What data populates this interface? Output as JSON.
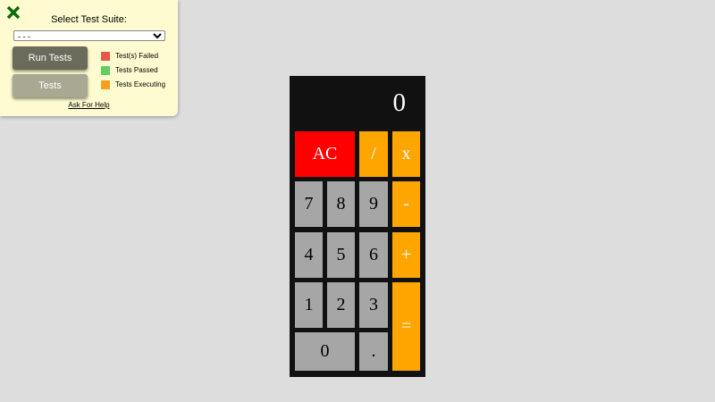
{
  "test_panel": {
    "close_icon": "close-x-icon",
    "title": "Select Test Suite:",
    "select_value": "- - -",
    "run_button": "Run Tests",
    "tests_button": "Tests",
    "legend": [
      {
        "label": "Test(s) Failed",
        "color": "#e8574a"
      },
      {
        "label": "Tests Passed",
        "color": "#5fcf5f"
      },
      {
        "label": "Tests Executing",
        "color": "#f5a021"
      }
    ],
    "help_link": "Ask For Help"
  },
  "calculator": {
    "display": "0",
    "keys": {
      "clear": "AC",
      "divide": "/",
      "multiply": "x",
      "seven": "7",
      "eight": "8",
      "nine": "9",
      "subtract": "-",
      "four": "4",
      "five": "5",
      "six": "6",
      "add": "+",
      "one": "1",
      "two": "2",
      "three": "3",
      "equals": "=",
      "zero": "0",
      "decimal": "."
    },
    "colors": {
      "number": "#a6a6a6",
      "operator": "#ffa500",
      "clear": "#ff0000",
      "body": "#111111"
    }
  }
}
